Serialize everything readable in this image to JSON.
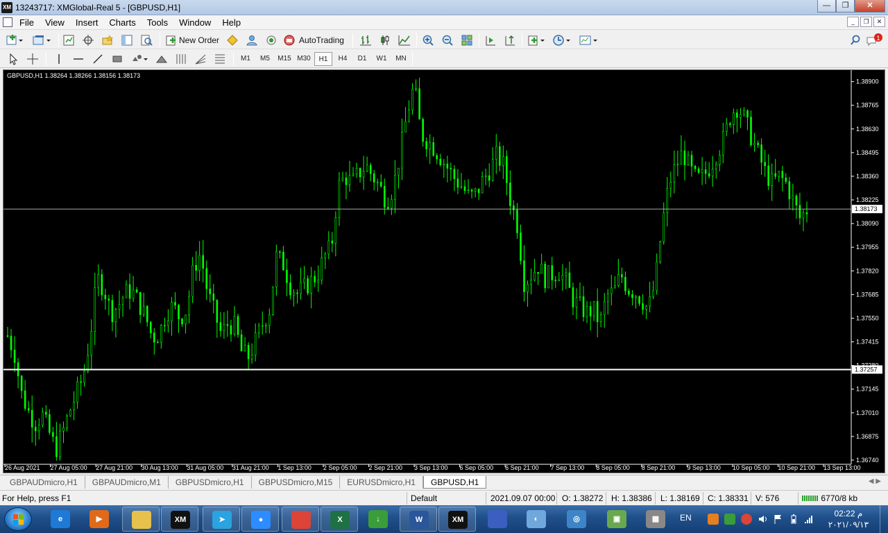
{
  "window": {
    "app_icon": "XM",
    "title": "13243717: XMGlobal-Real 5 - [GBPUSD,H1]",
    "minimize_glyph": "—",
    "restore_glyph": "❐",
    "close_glyph": "✕"
  },
  "menu": {
    "items": [
      "File",
      "View",
      "Insert",
      "Charts",
      "Tools",
      "Window",
      "Help"
    ],
    "mdi_minimize": "_",
    "mdi_restore": "❐",
    "mdi_close": "✕",
    "notification_count": "1"
  },
  "toolbar": {
    "new_order_label": "New Order",
    "autotrading_label": "AutoTrading"
  },
  "timeframes": {
    "items": [
      "M1",
      "M5",
      "M15",
      "M30",
      "H1",
      "H4",
      "D1",
      "W1",
      "MN"
    ],
    "active": "H1"
  },
  "chart": {
    "header": "GBPUSD,H1  1.38264 1.38266 1.38156 1.38173",
    "background": "#000000",
    "candle_color": "#00ff00",
    "bid_line_color": "#bfbfbf",
    "bid_label": "1.38173",
    "hline_label": "1.37257",
    "hline_color": "#ffffff"
  },
  "chart_data": {
    "type": "candlestick",
    "symbol": "GBPUSD",
    "timeframe": "H1",
    "ylim": [
      1.3674,
      1.3895
    ],
    "y_ticks": [
      "1.38900",
      "1.38765",
      "1.38630",
      "1.38495",
      "1.38360",
      "1.38225",
      "1.38090",
      "1.37955",
      "1.37820",
      "1.37685",
      "1.37550",
      "1.37415",
      "1.37280",
      "1.37145",
      "1.37010",
      "1.36875",
      "1.36740"
    ],
    "x_ticks": [
      "26 Aug 2021",
      "27 Aug 05:00",
      "27 Aug 21:00",
      "30 Aug 13:00",
      "31 Aug 05:00",
      "31 Aug 21:00",
      "1 Sep 13:00",
      "2 Sep 05:00",
      "2 Sep 21:00",
      "3 Sep 13:00",
      "6 Sep 05:00",
      "6 Sep 21:00",
      "7 Sep 13:00",
      "8 Sep 05:00",
      "8 Sep 21:00",
      "9 Sep 13:00",
      "10 Sep 05:00",
      "10 Sep 21:00",
      "13 Sep 13:00"
    ],
    "close_path": [
      1.3745,
      1.3735,
      1.3712,
      1.3702,
      1.3695,
      1.37,
      1.369,
      1.368,
      1.369,
      1.3702,
      1.3712,
      1.3722,
      1.3745,
      1.3778,
      1.3772,
      1.3758,
      1.3762,
      1.3769,
      1.3771,
      1.3764,
      1.3756,
      1.3744,
      1.3746,
      1.3758,
      1.3762,
      1.3755,
      1.376,
      1.3784,
      1.3792,
      1.377,
      1.3758,
      1.3746,
      1.3752,
      1.375,
      1.3735,
      1.3733,
      1.3742,
      1.3752,
      1.376,
      1.379,
      1.3786,
      1.3774,
      1.3769,
      1.3772,
      1.3776,
      1.378,
      1.379,
      1.3796,
      1.383,
      1.3836,
      1.3832,
      1.3838,
      1.3842,
      1.3836,
      1.383,
      1.3822,
      1.383,
      1.385,
      1.3872,
      1.3888,
      1.386,
      1.3856,
      1.3852,
      1.3846,
      1.384,
      1.3834,
      1.383,
      1.3824,
      1.3826,
      1.3834,
      1.384,
      1.3848,
      1.3842,
      1.3822,
      1.3808,
      1.3775,
      1.378,
      1.3785,
      1.3778,
      1.378,
      1.3782,
      1.3776,
      1.3766,
      1.3762,
      1.3758,
      1.376,
      1.3752,
      1.3768,
      1.377,
      1.378,
      1.3772,
      1.377,
      1.3766,
      1.376,
      1.3775,
      1.3808,
      1.3832,
      1.3842,
      1.385,
      1.384,
      1.3834,
      1.3836,
      1.3842,
      1.385,
      1.3858,
      1.3872,
      1.3876,
      1.3868,
      1.3858,
      1.3848,
      1.3838,
      1.3832,
      1.3836,
      1.3832,
      1.3822,
      1.3812,
      1.3817
    ],
    "bid_price": 1.38173,
    "hline_price": 1.37257
  },
  "tabs": {
    "items": [
      "GBPAUDmicro,H1",
      "GBPAUDmicro,M1",
      "GBPUSDmicro,H1",
      "GBPUSDmicro,M15",
      "EURUSDmicro,H1",
      "GBPUSD,H1"
    ],
    "active": "GBPUSD,H1",
    "arrows": "◀ ▶"
  },
  "status": {
    "help": "For Help, press F1",
    "profile": "Default",
    "datetime": "2021.09.07 00:00",
    "open": "O: 1.38272",
    "high": "H: 1.38386",
    "low": "L: 1.38169",
    "close": "C: 1.38331",
    "volume": "V: 576",
    "traffic": "6770/8 kb"
  },
  "taskbar": {
    "language": "EN",
    "time": "م 02:22",
    "date": "٢٠٢١/٠٩/١٣",
    "apps": [
      {
        "name": "internet-explorer",
        "label": "e",
        "color": "#1e7ad6"
      },
      {
        "name": "media-player",
        "label": "▶",
        "color": "#e06a1a"
      },
      {
        "name": "file-explorer",
        "label": "",
        "color": "#e8c14d"
      },
      {
        "name": "xm-app",
        "label": "XM",
        "color": "#111111"
      },
      {
        "name": "telegram",
        "label": "➤",
        "color": "#2aa3e0"
      },
      {
        "name": "zoom",
        "label": "●",
        "color": "#2d8cff"
      },
      {
        "name": "chrome",
        "label": "",
        "color": "#db4437"
      },
      {
        "name": "excel",
        "label": "X",
        "color": "#1e7145"
      },
      {
        "name": "internet-download-manager",
        "label": "↓",
        "color": "#3a9d3a"
      },
      {
        "name": "word",
        "label": "W",
        "color": "#2b579a"
      },
      {
        "name": "xm-terminal",
        "label": "XM",
        "color": "#111111"
      },
      {
        "name": "network-app",
        "label": "",
        "color": "#3b5fc0"
      },
      {
        "name": "speed-app",
        "label": "◐",
        "color": "#6fa8dc"
      },
      {
        "name": "browser-app",
        "label": "◎",
        "color": "#3d85c6"
      },
      {
        "name": "files-app",
        "label": "▣",
        "color": "#6aa84f"
      },
      {
        "name": "calculator",
        "label": "▦",
        "color": "#888888"
      }
    ]
  }
}
